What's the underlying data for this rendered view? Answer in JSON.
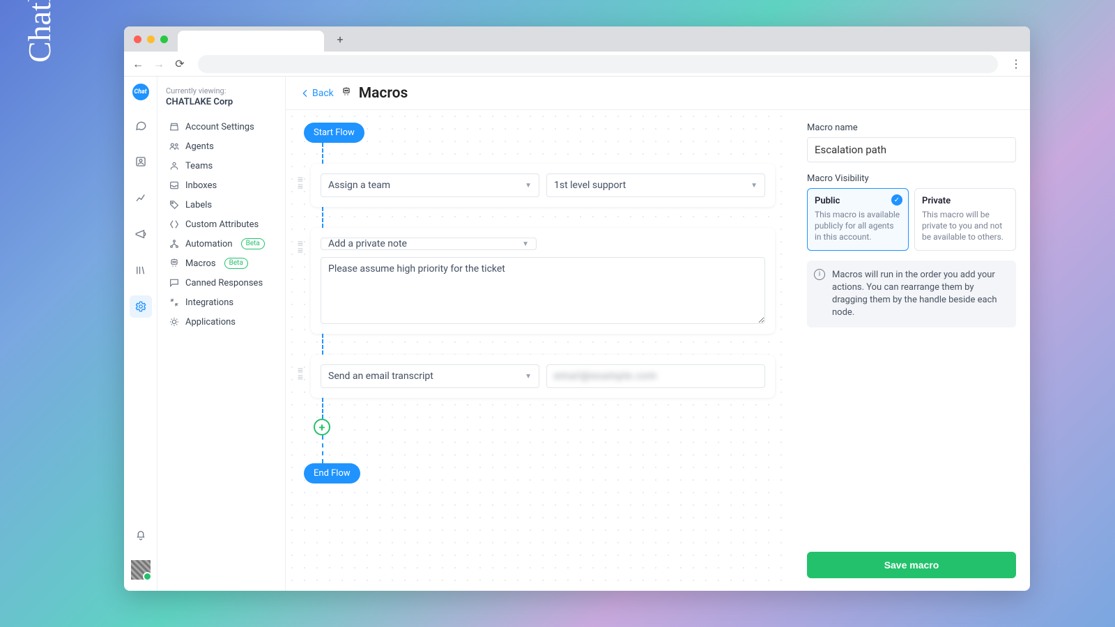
{
  "brand": "Chatlake",
  "browser": {
    "tab_title": "",
    "plus": "+"
  },
  "rail": {
    "logo_text": "Chat"
  },
  "sidebar": {
    "viewing_label": "Currently viewing:",
    "org_name": "CHATLAKE Corp",
    "items": [
      {
        "label": "Account Settings"
      },
      {
        "label": "Agents"
      },
      {
        "label": "Teams"
      },
      {
        "label": "Inboxes"
      },
      {
        "label": "Labels"
      },
      {
        "label": "Custom Attributes"
      },
      {
        "label": "Automation",
        "badge": "Beta"
      },
      {
        "label": "Macros",
        "badge": "Beta"
      },
      {
        "label": "Canned Responses"
      },
      {
        "label": "Integrations"
      },
      {
        "label": "Applications"
      }
    ]
  },
  "header": {
    "back": "Back",
    "title": "Macros"
  },
  "flow": {
    "start": "Start Flow",
    "end": "End Flow",
    "nodes": [
      {
        "action": "Assign a team",
        "value": "1st level support"
      },
      {
        "action": "Add a private note",
        "text": "Please assume high priority for the ticket"
      },
      {
        "action": "Send an email transcript",
        "value": "email@example.com"
      }
    ]
  },
  "panel": {
    "name_label": "Macro name",
    "name_value": "Escalation path",
    "vis_label": "Macro Visibility",
    "public": {
      "title": "Public",
      "desc": "This macro is available publicly for all agents in this account."
    },
    "private": {
      "title": "Private",
      "desc": "This macro will be private to you and not be available to others."
    },
    "info": "Macros will run in the order you add your actions. You can rearrange them by dragging them by the handle beside each node.",
    "save": "Save macro"
  }
}
